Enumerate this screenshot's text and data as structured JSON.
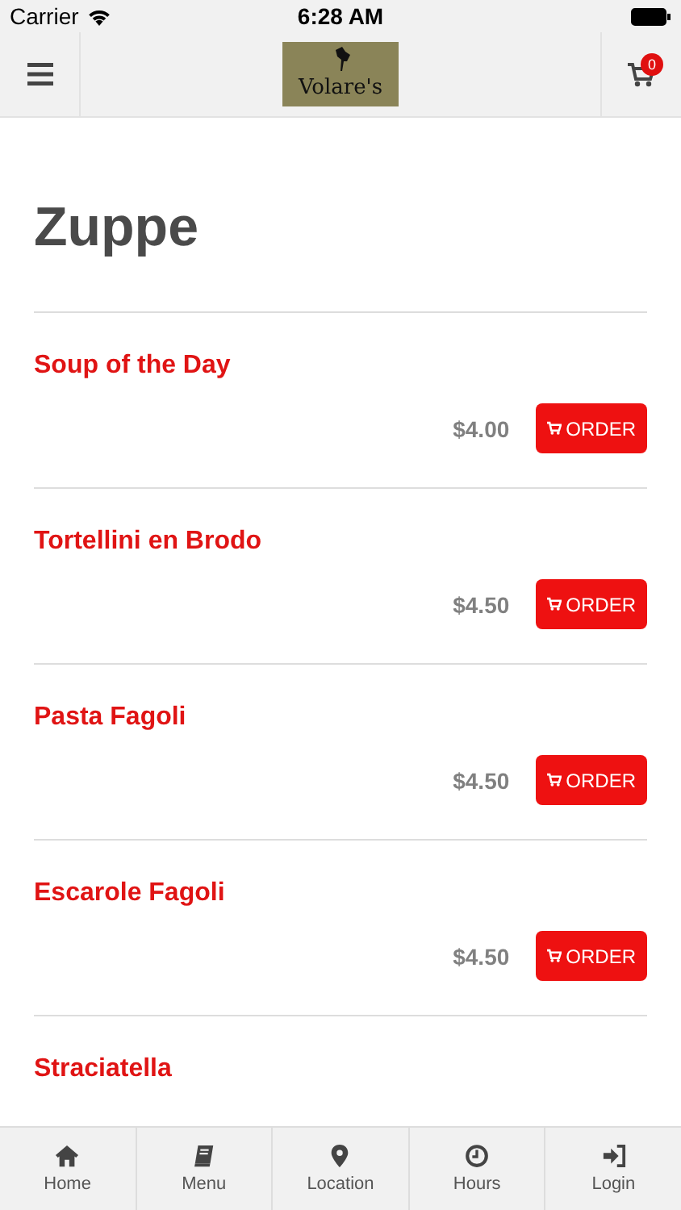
{
  "status_bar": {
    "carrier": "Carrier",
    "time": "6:28 AM"
  },
  "nav": {
    "logo_text": "Volare's",
    "cart_count": "0"
  },
  "section": {
    "title": "Zuppe"
  },
  "items": [
    {
      "name": "Soup of the Day",
      "price": "$4.00",
      "order_label": "ORDER"
    },
    {
      "name": "Tortellini en Brodo",
      "price": "$4.50",
      "order_label": "ORDER"
    },
    {
      "name": "Pasta Fagoli",
      "price": "$4.50",
      "order_label": "ORDER"
    },
    {
      "name": "Escarole Fagoli",
      "price": "$4.50",
      "order_label": "ORDER"
    },
    {
      "name": "Straciatella"
    }
  ],
  "tabs": [
    {
      "label": "Home",
      "kind": "home"
    },
    {
      "label": "Menu",
      "kind": "book"
    },
    {
      "label": "Location",
      "kind": "pin"
    },
    {
      "label": "Hours",
      "kind": "clock"
    },
    {
      "label": "Login",
      "kind": "login"
    }
  ]
}
